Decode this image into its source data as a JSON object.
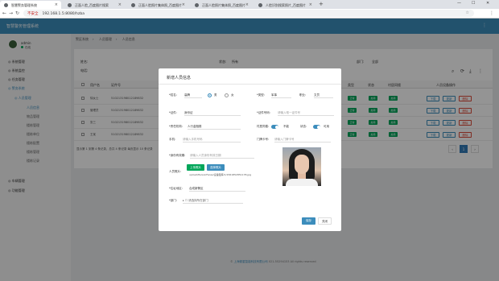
{
  "browser": {
    "tabs": [
      {
        "label": "智慧警务管理系统"
      },
      {
        "label": "正面人脸_百度图片搜索"
      },
      {
        "label": "正面人脸照片集体照_百度图片"
      },
      {
        "label": "正面人脸照片集体照_百度图片"
      },
      {
        "label": "人脸识别搜索照片_百度图片"
      }
    ],
    "new_tab": "+",
    "minimize": "—",
    "maximize": "☐",
    "close": "✕",
    "security_label": "不安全",
    "url": "192.168.1.5:8080/hzba",
    "back": "←",
    "forward": "→",
    "reload": "↻",
    "star": "☆",
    "menu": "⋮"
  },
  "app": {
    "title": "智慧警务管理系统",
    "header_menu": "⋮",
    "user": {
      "name": "admin",
      "status": "在线"
    },
    "sidebar": [
      {
        "label": "◎ 系统管理"
      },
      {
        "label": "◎ 系统监控"
      },
      {
        "label": "◎ 任务管理"
      },
      {
        "label": "◎ 警务系统"
      },
      {
        "label": "◎ 人员管理"
      }
    ],
    "sidebar_sub": [
      {
        "label": "人员信息"
      },
      {
        "label": "物品管理"
      },
      {
        "label": "楼栋管理"
      },
      {
        "label": "楼栋单位"
      },
      {
        "label": "楼栋配置"
      },
      {
        "label": "楼栋管理"
      },
      {
        "label": "楼栋记录"
      }
    ],
    "sidebar_tail": [
      {
        "label": "◎ 车辆管理"
      },
      {
        "label": "◎ 功能管理"
      }
    ],
    "breadcrumb": [
      "警区系统",
      "人员管理",
      "人员信息"
    ],
    "filters": {
      "name_label": "姓名:",
      "status_label": "状态:",
      "status_value": "所有",
      "dept_label": "部门:",
      "dept_value": "全部",
      "phone_label": "电话:"
    },
    "toolbar_icons": [
      "search-icon",
      "refresh-icon",
      "export-icon",
      "more-icon"
    ],
    "table": {
      "headers": [
        "用户名",
        "证件号",
        "类型",
        "状态",
        "村居同楼",
        "人员设备操作"
      ],
      "rows": [
        {
          "name": "徐女士",
          "id_no": "510213198012189832",
          "type": "正常",
          "status": "启用",
          "flag": "启用",
          "ops": [
            "下载",
            "更新",
            "删除"
          ]
        },
        {
          "name": "管理员",
          "id_no": "510213198012189832",
          "type": "正常",
          "status": "启用",
          "flag": "启用",
          "ops": [
            "下载",
            "更新",
            "删除"
          ]
        },
        {
          "name": "张三",
          "id_no": "510213198012189832",
          "type": "正常",
          "status": "启用",
          "flag": "启用",
          "ops": [
            "下载",
            "更新",
            "删除"
          ]
        },
        {
          "name": "王某",
          "id_no": "510213198012189832",
          "type": "正常",
          "status": "启用",
          "flag": "启用",
          "ops": [
            "下载",
            "更新",
            "删除"
          ]
        }
      ]
    },
    "page_info": "显示第 1 到第 4 条记录，总共 4 条记录 每页显示 10 条记录",
    "pager": {
      "prev": "‹",
      "current": "1",
      "next": "›"
    },
    "footer": {
      "prefix": "© ",
      "company": "上海繁星智能科技有限公司",
      "suffix": " 021-55294153 All rights reserved"
    }
  },
  "modal": {
    "title": "新增人员信息",
    "fields": {
      "name_label": "*姓名:",
      "name_value": "高腾",
      "gender_label": "",
      "gender_male": "男",
      "gender_female": "女",
      "type_label": "*类型:",
      "type_value": "军事",
      "job_label": "职业:",
      "job_value": "文员",
      "cert_label": "*证件:",
      "cert_value": "身份证",
      "cert_no_label": "*证件号码:",
      "cert_no_placeholder": "请输入唯一证件号",
      "dept_label": "*责任机构:",
      "dept_value": "人行金融委",
      "joint_label": "村居同楼:",
      "joint_off": "不能",
      "state_label": "状态:",
      "state_value": "可用",
      "phone_label": "手机:",
      "phone_placeholder": "请输入手机号码",
      "door_label": "门牌卡号:",
      "door_placeholder": "请输入门牌卡号",
      "note_label": "*身份有效期:",
      "note_placeholder": "请输入人员身份有效日期",
      "photo_label": "人员照片:",
      "upload_btn": "上传照片",
      "select_btn": "选择照片",
      "upload_path": "upload/PersonFaces/设备图库/1/1561852851178.jpg",
      "addr_label": "*住址地区:",
      "addr_value": "合成新警区",
      "dept2_label": "*部门:",
      "dept2_placeholder": "▸  ☐ 请选择所在部门"
    },
    "ok_button": "保存",
    "cancel_button": "关闭"
  }
}
